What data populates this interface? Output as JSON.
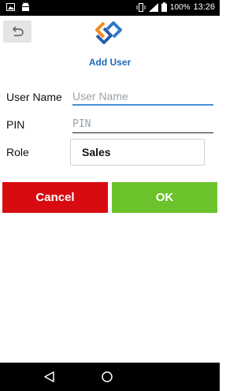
{
  "status_bar": {
    "battery": "100%",
    "time": "13:26",
    "icons": [
      "image-icon",
      "android-icon",
      "vibrate-icon",
      "signal-4g-icon",
      "battery-icon"
    ]
  },
  "header": {
    "back_icon": "back-arrow-icon",
    "logo_icon": "diamond-logo-icon",
    "title": "Add User"
  },
  "form": {
    "user_name_label": "User Name",
    "user_name_placeholder": "User Name",
    "pin_label": "PIN",
    "pin_placeholder": "PIN",
    "role_label": "Role",
    "role_value": "Sales"
  },
  "actions": {
    "cancel_label": "Cancel",
    "ok_label": "OK"
  },
  "colors": {
    "title": "#1e6ab5",
    "cancel": "#d80b10",
    "ok": "#6cc22b",
    "focus_underline": "#4a8fd6"
  },
  "nav_bar": {
    "icons": [
      "nav-back-icon",
      "nav-home-icon"
    ]
  }
}
